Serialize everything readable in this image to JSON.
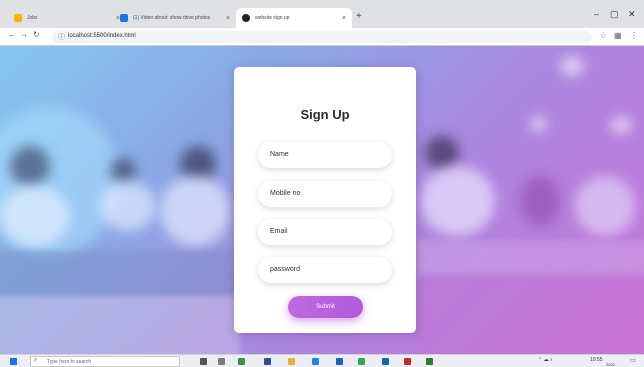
{
  "browser": {
    "tabs": [
      {
        "title": "Jobs",
        "active": false
      },
      {
        "title": "(1) Video about: show drive photos",
        "active": false
      },
      {
        "title": "website sign up",
        "active": true
      }
    ],
    "url": "localhost:5500/index.html"
  },
  "form": {
    "title": "Sign Up",
    "fields": [
      {
        "placeholder": "Name"
      },
      {
        "placeholder": "Mobile no"
      },
      {
        "placeholder": "Email"
      },
      {
        "placeholder": "password"
      }
    ],
    "submit_label": "Submit"
  },
  "taskbar": {
    "search_placeholder": "Type here to search",
    "time": "10:55",
    "date": "2022"
  },
  "colors": {
    "accent": "#b862dc",
    "background_gradient": [
      "#86c7ee",
      "#c775d8"
    ]
  }
}
